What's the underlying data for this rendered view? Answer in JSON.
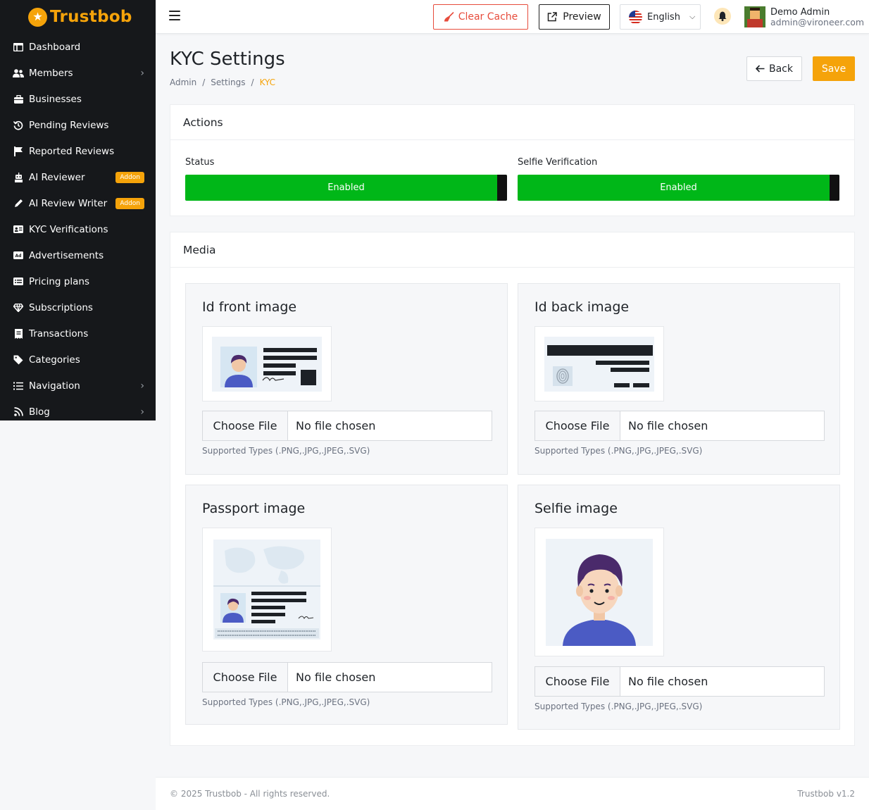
{
  "brand": {
    "name": "Trustbob"
  },
  "sidebar": {
    "items": [
      {
        "label": "Dashboard",
        "icon": "dashboard-icon"
      },
      {
        "label": "Members",
        "icon": "users-icon",
        "chevron": true
      },
      {
        "label": "Businesses",
        "icon": "briefcase-icon"
      },
      {
        "label": "Pending Reviews",
        "icon": "history-icon"
      },
      {
        "label": "Reported Reviews",
        "icon": "flag-icon"
      },
      {
        "label": "AI Reviewer",
        "icon": "robot-icon",
        "badge": "Addon"
      },
      {
        "label": "AI Review Writer",
        "icon": "pen-icon",
        "badge": "Addon"
      },
      {
        "label": "KYC Verifications",
        "icon": "id-card-icon"
      },
      {
        "label": "Advertisements",
        "icon": "ad-icon"
      },
      {
        "label": "Pricing plans",
        "icon": "pricing-icon"
      },
      {
        "label": "Subscriptions",
        "icon": "gem-icon"
      },
      {
        "label": "Transactions",
        "icon": "receipt-icon"
      },
      {
        "label": "Categories",
        "icon": "tag-icon"
      },
      {
        "label": "Navigation",
        "icon": "list-icon",
        "chevron": true
      },
      {
        "label": "Blog",
        "icon": "rss-icon",
        "chevron": true
      }
    ]
  },
  "topbar": {
    "clear_cache": "Clear Cache",
    "preview": "Preview",
    "language": "English",
    "user_name": "Demo Admin",
    "user_email": "admin@vironeer.com"
  },
  "page": {
    "title": "KYC Settings",
    "breadcrumb": [
      "Admin",
      "Settings",
      "KYC"
    ],
    "back": "Back",
    "save": "Save"
  },
  "actions": {
    "title": "Actions",
    "status_label": "Status",
    "status_value": "Enabled",
    "selfie_label": "Selfie Verification",
    "selfie_value": "Enabled"
  },
  "media": {
    "title": "Media",
    "items": [
      {
        "title": "Id front image",
        "choose": "Choose File",
        "file": "No file chosen",
        "help": "Supported Types (.PNG,.JPG,.JPEG,.SVG)"
      },
      {
        "title": "Id back image",
        "choose": "Choose File",
        "file": "No file chosen",
        "help": "Supported Types (.PNG,.JPG,.JPEG,.SVG)"
      },
      {
        "title": "Passport image",
        "choose": "Choose File",
        "file": "No file chosen",
        "help": "Supported Types (.PNG,.JPG,.JPEG,.SVG)"
      },
      {
        "title": "Selfie image",
        "choose": "Choose File",
        "file": "No file chosen",
        "help": "Supported Types (.PNG,.JPG,.JPEG,.SVG)"
      }
    ]
  },
  "footer": {
    "copyright": "© 2025 Trustbob - All rights reserved.",
    "version": "Trustbob v1.2"
  },
  "colors": {
    "accent": "#f5a30a",
    "danger": "#e74c3c",
    "enabled": "#00b718",
    "sidebar": "#16181b"
  }
}
